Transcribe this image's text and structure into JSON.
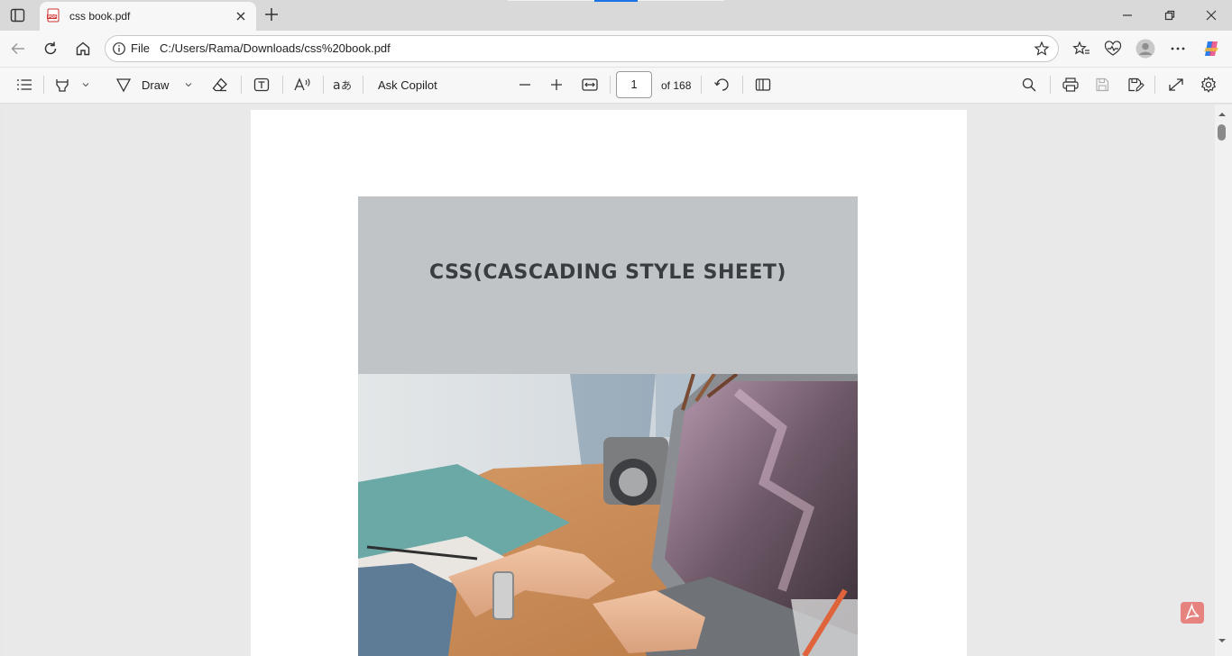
{
  "tab": {
    "title": "css book.pdf",
    "favicon": "pdf-icon"
  },
  "address": {
    "scheme_label": "File",
    "url": "C:/Users/Rama/Downloads/css%20book.pdf"
  },
  "toolbar": {
    "draw_label": "Draw",
    "ask_copilot_label": "Ask Copilot",
    "page_number": "1",
    "page_count_label": "of 168"
  },
  "document": {
    "cover_title": "CSS(CASCADING STYLE SHEET)"
  },
  "colors": {
    "cover_band": "#c0c4c7",
    "title_text": "#3a3d40",
    "acrobat_badge": "#e7837f"
  }
}
